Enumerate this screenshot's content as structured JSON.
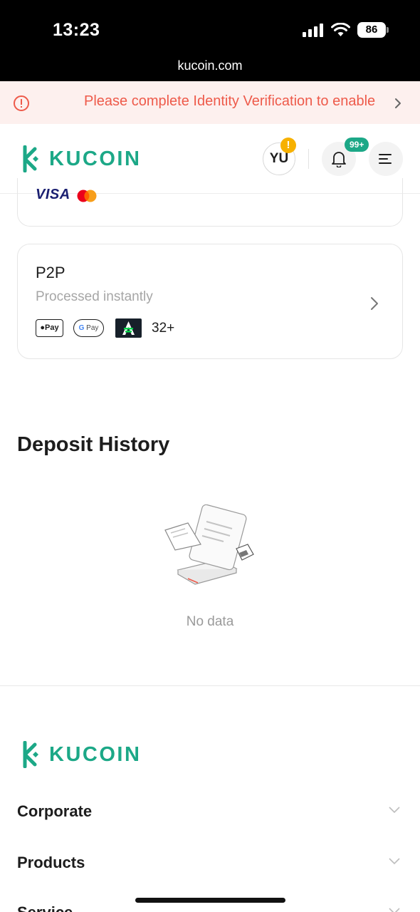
{
  "status_bar": {
    "time": "13:23",
    "battery": "86"
  },
  "browser": {
    "url": "kucoin.com"
  },
  "banner": {
    "text": "Please complete Identity Verification to enable",
    "color": "#ee5a4a",
    "background": "#fdf0ee"
  },
  "header": {
    "logo_text": "KUCOIN",
    "avatar_initials": "YU",
    "avatar_alert": "!",
    "notification_badge": "99+",
    "brand_color": "#1ca887"
  },
  "card_fragment": {
    "visa_label": "VISA",
    "icons": [
      "visa-logo",
      "mastercard-logo"
    ]
  },
  "p2p": {
    "title": "P2P",
    "subtitle": "Processed instantly",
    "apple_pay": "Pay",
    "google_pay": "Pay",
    "more_methods": "32+",
    "icons": [
      "apple-pay-logo",
      "google-pay-logo",
      "cash-app-logo",
      "chevron-right-icon"
    ]
  },
  "deposit_history": {
    "title": "Deposit History",
    "empty_text": "No data"
  },
  "footer": {
    "logo_text": "KUCOIN",
    "sections": [
      {
        "label": "Corporate"
      },
      {
        "label": "Products"
      },
      {
        "label": "Service"
      }
    ]
  }
}
